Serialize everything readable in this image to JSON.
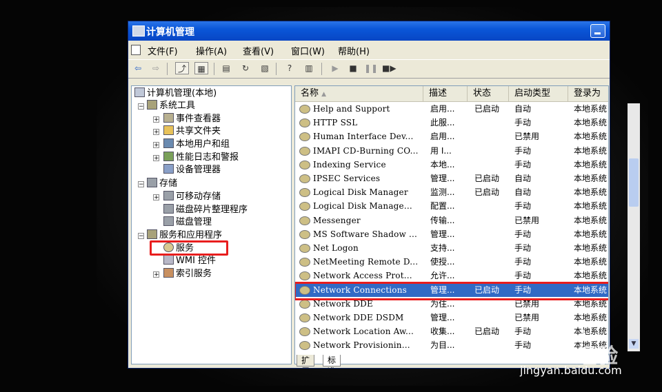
{
  "window": {
    "title": "计算机管理"
  },
  "menu": [
    "文件(F)",
    "操作(A)",
    "查看(V)",
    "窗口(W)",
    "帮助(H)"
  ],
  "tree": {
    "root": "计算机管理(本地)",
    "system_tools": "系统工具",
    "event_viewer": "事件查看器",
    "shared_folders": "共享文件夹",
    "local_users": "本地用户和组",
    "perf_logs": "性能日志和警报",
    "device_manager": "设备管理器",
    "storage": "存储",
    "removable": "可移动存储",
    "defrag": "磁盘碎片整理程序",
    "disk_mgmt": "磁盘管理",
    "services_apps": "服务和应用程序",
    "services": "服务",
    "wmi": "WMI 控件",
    "indexing": "索引服务"
  },
  "list": {
    "headers": [
      "名称",
      "描述",
      "状态",
      "启动类型",
      "登录为"
    ],
    "rows": [
      [
        "Help and Support",
        "启用...",
        "已启动",
        "自动",
        "本地系统"
      ],
      [
        "HTTP SSL",
        "此服...",
        "",
        "手动",
        "本地系统"
      ],
      [
        "Human Interface Dev...",
        "启用...",
        "",
        "已禁用",
        "本地系统"
      ],
      [
        "IMAPI CD-Burning CO...",
        "用 I...",
        "",
        "手动",
        "本地系统"
      ],
      [
        "Indexing Service",
        "本地...",
        "",
        "手动",
        "本地系统"
      ],
      [
        "IPSEC Services",
        "管理...",
        "已启动",
        "自动",
        "本地系统"
      ],
      [
        "Logical Disk Manager",
        "监测...",
        "已启动",
        "自动",
        "本地系统"
      ],
      [
        "Logical Disk Manage...",
        "配置...",
        "",
        "手动",
        "本地系统"
      ],
      [
        "Messenger",
        "传输...",
        "",
        "已禁用",
        "本地系统"
      ],
      [
        "MS Software Shadow ...",
        "管理...",
        "",
        "手动",
        "本地系统"
      ],
      [
        "Net Logon",
        "支持...",
        "",
        "手动",
        "本地系统"
      ],
      [
        "NetMeeting Remote D...",
        "使授...",
        "",
        "手动",
        "本地系统"
      ],
      [
        "Network Access Prot...",
        "允许...",
        "",
        "手动",
        "本地系统"
      ],
      [
        "Network Connections",
        "管理...",
        "已启动",
        "手动",
        "本地系统"
      ],
      [
        "Network DDE",
        "为住...",
        "",
        "已禁用",
        "本地系统"
      ],
      [
        "Network DDE DSDM",
        "管理...",
        "",
        "已禁用",
        "本地系统"
      ],
      [
        "Network Location Aw...",
        "收集...",
        "已启动",
        "手动",
        "本地系统"
      ],
      [
        "Network Provisionin...",
        "为目...",
        "",
        "手动",
        "本地系统"
      ]
    ]
  },
  "tabs": [
    "扩展",
    "标准"
  ],
  "watermark": {
    "logo": "Baidu经验",
    "site": "jingyan.baidu.com"
  },
  "colors": {
    "highlight_box": "#e81d1d",
    "titlebar": "#0a56d8",
    "selection": "#316ac5"
  }
}
